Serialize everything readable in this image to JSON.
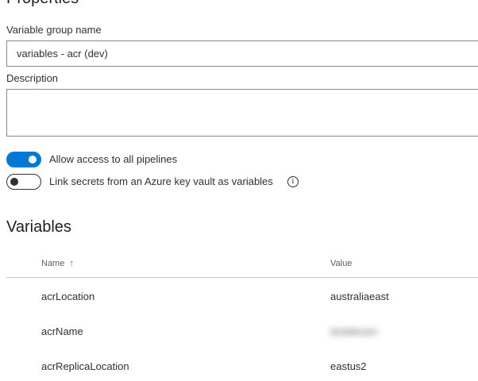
{
  "properties": {
    "title": "Properties",
    "group_name_label": "Variable group name",
    "group_name_value": "variables - acr (dev)",
    "description_label": "Description",
    "description_value": ""
  },
  "toggles": {
    "allow_access_label": "Allow access to all pipelines",
    "allow_access_on": true,
    "link_secrets_label": "Link secrets from an Azure key vault as variables",
    "link_secrets_on": false
  },
  "variables": {
    "title": "Variables",
    "columns": {
      "name": "Name",
      "value": "Value",
      "sort_glyph": "↑"
    },
    "rows": [
      {
        "name": "acrLocation",
        "value": "australiaeast"
      },
      {
        "name": "acrName",
        "value": "testdevacr"
      },
      {
        "name": "acrReplicaLocation",
        "value": "eastus2"
      }
    ]
  },
  "icons": {
    "info": "info-icon",
    "sort": "arrow-up-icon"
  },
  "colors": {
    "accent": "#0078d4",
    "text": "#323130",
    "secondary_text": "#605e5c",
    "border": "#8a8886"
  }
}
